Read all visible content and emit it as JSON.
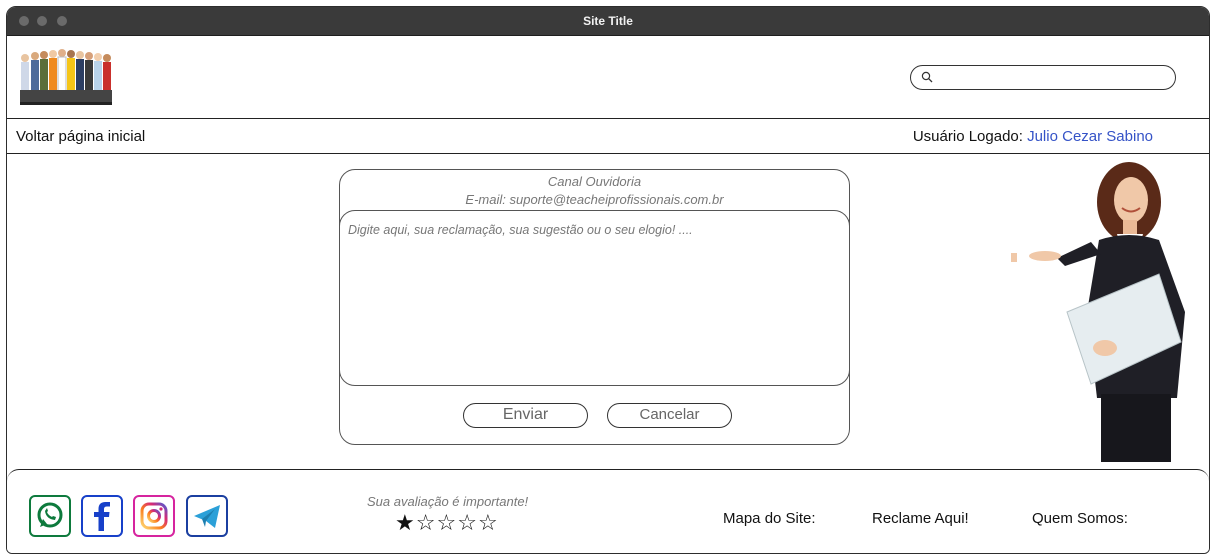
{
  "window": {
    "title": "Site Title"
  },
  "header": {
    "logo_alt": "professionals-group-logo",
    "search": {
      "placeholder": "",
      "value": ""
    }
  },
  "nav": {
    "home_label": "Voltar página inicial",
    "user_prefix": "Usuário Logado:",
    "user_name": "Julio Cezar Sabino"
  },
  "ouvidoria": {
    "title": "Canal Ouvidoria",
    "email": "E-mail: suporte@teacheiprofissionais.com.br",
    "message_placeholder": "Digite aqui, sua reclamação, sua sugestão ou o seu elogio! ....",
    "send_label": "Enviar",
    "cancel_label": "Cancelar"
  },
  "footer": {
    "social": [
      "whatsapp-icon",
      "facebook-icon",
      "instagram-icon",
      "telegram-icon"
    ],
    "rating_label": "Sua avaliação é importante!",
    "rating": {
      "value": 1,
      "max": 5
    },
    "links": [
      "Mapa do Site:",
      "Reclame Aqui!",
      "Quem Somos:"
    ]
  },
  "colors": {
    "titlebar": "#3a3a3a",
    "user_name": "#3553c7",
    "whatsapp": "#0e7a3d",
    "facebook": "#1740c9",
    "telegram": "#2ba0d8"
  }
}
